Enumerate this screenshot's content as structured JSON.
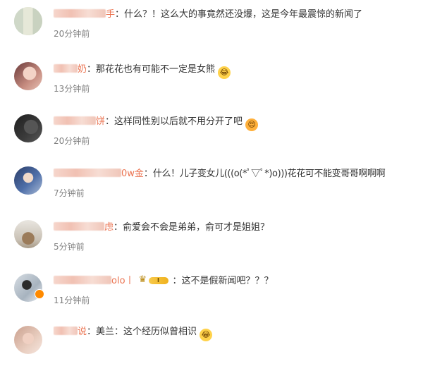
{
  "comments": [
    {
      "name_visible": "手",
      "text": "什么？！这么大的事竟然还没爆，这是今年最震惊的新闻了",
      "time": "20分钟前",
      "emoji": ""
    },
    {
      "name_visible": "奶",
      "text": "那花花也有可能不一定是女熊",
      "time": "13分钟前",
      "emoji": "laugh-emoji"
    },
    {
      "name_visible": "饼",
      "text": "这样同性别以后就不用分开了吧",
      "time": "20分钟前",
      "emoji": "love-emoji"
    },
    {
      "name_visible": "0w金",
      "text": "什么！儿子变女儿(((o(*ﾟ▽ﾟ*)o)))花花可不能变哥哥啊啊啊",
      "time": "7分钟前",
      "emoji": ""
    },
    {
      "name_visible": "虑",
      "text": "俞爱会不会是弟弟，俞可才是姐姐？",
      "time": "5分钟前",
      "emoji": ""
    },
    {
      "name_visible": "olo丨",
      "text": "这不是假新闻吧？？？",
      "time": "11分钟前",
      "badge": "I",
      "emoji": ""
    },
    {
      "name_visible": "说",
      "text": "美兰：这个经历似曾相识",
      "time": "",
      "emoji": "laugh-emoji"
    }
  ],
  "colon": "：",
  "colors": {
    "name": "#eb7350",
    "text": "#333333",
    "time": "#808080"
  }
}
